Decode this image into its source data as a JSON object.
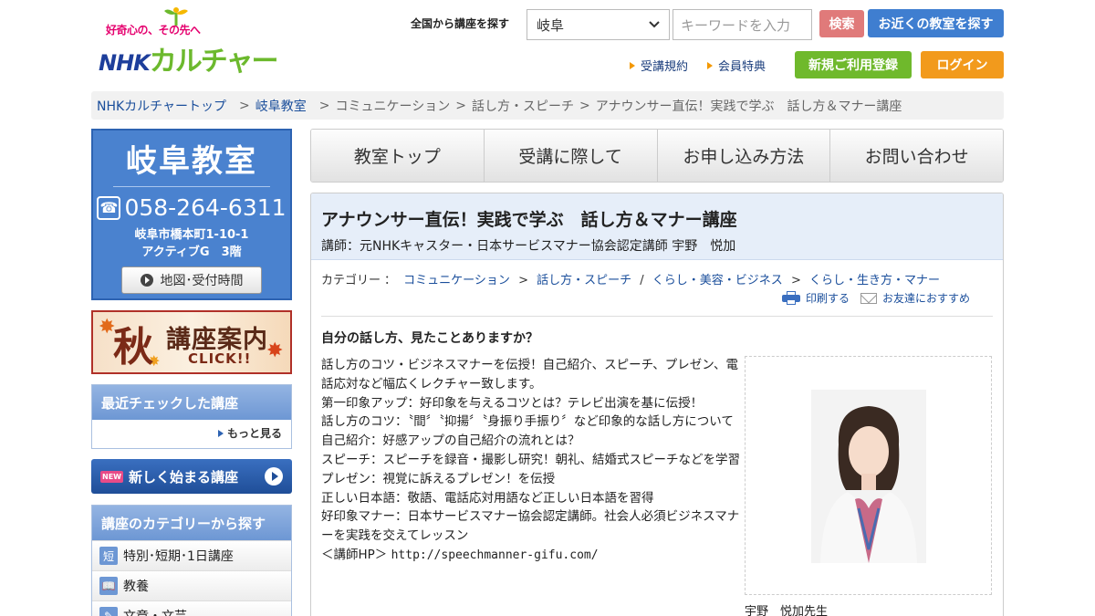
{
  "header": {
    "logo_tagline": "好奇心の、その先へ",
    "logo_nhk": "NHK",
    "logo_kana": "カルチャー",
    "search_label": "全国から講座を探す",
    "prefecture_selected": "岐阜",
    "keyword_placeholder": "キーワードを入力",
    "search_button": "検索",
    "nearby_button": "お近くの教室を探す",
    "terms_link": "受講規約",
    "benefits_link": "会員特典",
    "register_button": "新規ご利用登録",
    "login_button": "ログイン"
  },
  "breadcrumb": {
    "items": [
      "NHKカルチャートップ",
      "岐阜教室",
      "コミュニケーション",
      "話し方・スピーチ",
      "アナウンサー直伝！実践で学ぶ　話し方＆マナー講座"
    ],
    "separator": ">"
  },
  "sidebar": {
    "classroom_name": "岐阜教室",
    "phone": "058-264-6311",
    "address_line1": "岐阜市橋本町1-10-1",
    "address_line2": "アクティブG　3階",
    "map_button": "地図･受付時間",
    "banner_big": "秋",
    "banner_title": "講座案内",
    "banner_click": "CLICK!!",
    "recent_title": "最近チェックした講座",
    "recent_more": "もっと見る",
    "new_badge": "NEW",
    "new_courses": "新しく始まる講座",
    "category_title": "講座のカテゴリーから探す",
    "categories": [
      {
        "icon": "短",
        "label": "特別･短期･1日講座"
      },
      {
        "icon": "📖",
        "label": "教養"
      },
      {
        "icon": "✎",
        "label": "文章・文芸"
      }
    ]
  },
  "tabs": [
    "教室トップ",
    "受講に際して",
    "お申し込み方法",
    "お問い合わせ"
  ],
  "course": {
    "title": "アナウンサー直伝！実践で学ぶ　話し方＆マナー講座",
    "teacher": "講師：元NHKキャスター・日本サービスマナー協会認定講師 宇野　悦加",
    "category_label": "カテゴリー",
    "category_path": [
      "コミュニケーション",
      "話し方・スピーチ",
      "くらし・美容・ビジネス",
      "くらし・生き方・マナー"
    ],
    "print_link": "印刷する",
    "share_link": "お友達におすすめ",
    "headline": "自分の話し方、見たことありますか？",
    "description": [
      "話し方のコツ・ビジネスマナーを伝授！自己紹介、スピーチ、プレゼン、電話応対など幅広くレクチャー致します。",
      "第一印象アップ：好印象を与えるコツとは？テレビ出演を基に伝授！",
      "話し方のコツ：〝間〞〝抑揚〞〝身振り手振り〞など印象的な話し方について",
      "自己紹介：好感アップの自己紹介の流れとは？",
      "スピーチ：スピーチを録音・撮影し研究！朝礼、結婚式スピーチなどを学習",
      "プレゼン：視覚に訴えるプレゼン！を伝授",
      "正しい日本語：敬語、電話応対用語など正しい日本語を習得",
      "好印象マナー：日本サービスマナー協会認定講師。社会人必須ビジネスマナーを実践を交えてレッスン"
    ],
    "homepage_label": "＜講師HP＞",
    "homepage_url": "http://speechmanner-gifu.com/",
    "photo_caption": "宇野　悦加先生"
  },
  "colors": {
    "brand_blue": "#1d3e9b",
    "brand_green": "#6cb92d",
    "sidebar_blue": "#4a82cf",
    "register_green": "#6fb92c",
    "login_orange": "#f29a1c",
    "search_red": "#e07a7a",
    "nearby_blue": "#3f7ed0"
  }
}
